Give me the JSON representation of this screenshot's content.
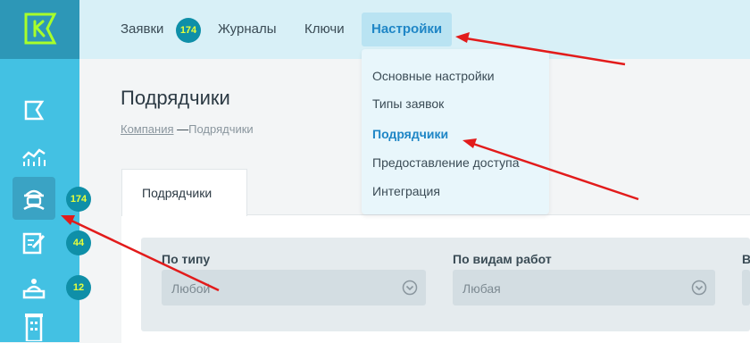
{
  "nav": {
    "requests": "Заявки",
    "requests_badge": "174",
    "journals": "Журналы",
    "keys": "Ключи",
    "settings": "Настройки"
  },
  "settings_menu": {
    "items": [
      "Основные настройки",
      "Типы заявок",
      "Подрядчики",
      "Предоставление доступа",
      "Интеграция"
    ],
    "active": "Подрядчики"
  },
  "sidebar": {
    "badges": [
      "174",
      "44",
      "12"
    ]
  },
  "page": {
    "title": "Подрядчики",
    "breadcrumb_root": "Компания",
    "breadcrumb_sep": "—",
    "breadcrumb_current": "Подрядчики",
    "tab": "Подрядчики"
  },
  "filters": {
    "by_type_label": "По типу",
    "by_type_value": "Любой",
    "by_work_label": "По видам работ",
    "by_work_value": "Любая",
    "third_label_fragment": "В"
  },
  "colors": {
    "sidebar": "#43c1e3",
    "topbar": "#d8f0f7",
    "accent": "#1f86c6",
    "badge": "#0f8fa8",
    "badge_text": "#e8ff3a",
    "arrow": "#e21b1b"
  }
}
